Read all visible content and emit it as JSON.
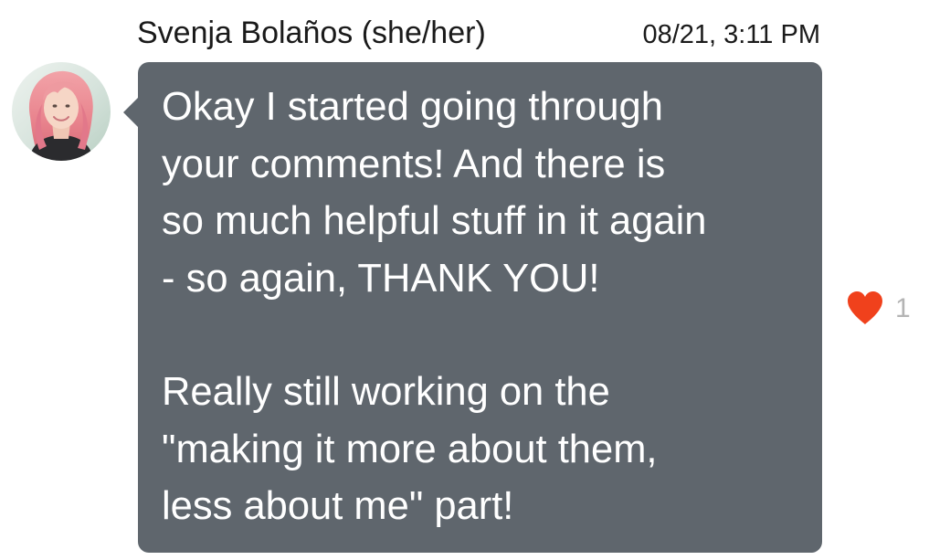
{
  "message": {
    "sender": "Svenja Bolaños (she/her)",
    "timestamp": "08/21, 3:11 PM",
    "paragraphs": [
      {
        "lines": [
          "Okay I started going through",
          "your comments! And there is",
          "so much helpful stuff in it again",
          "- so again, THANK YOU!"
        ]
      },
      {
        "lines": [
          "Really still working on the",
          "\"making it more about them,",
          "less about me\" part!"
        ]
      }
    ],
    "reaction": {
      "icon": "heart-icon",
      "count": "1",
      "color": "#f0411c"
    }
  },
  "colors": {
    "bubble": "#5f666d",
    "bubble_text": "#ffffff",
    "reaction_count": "#b4b4b4"
  }
}
